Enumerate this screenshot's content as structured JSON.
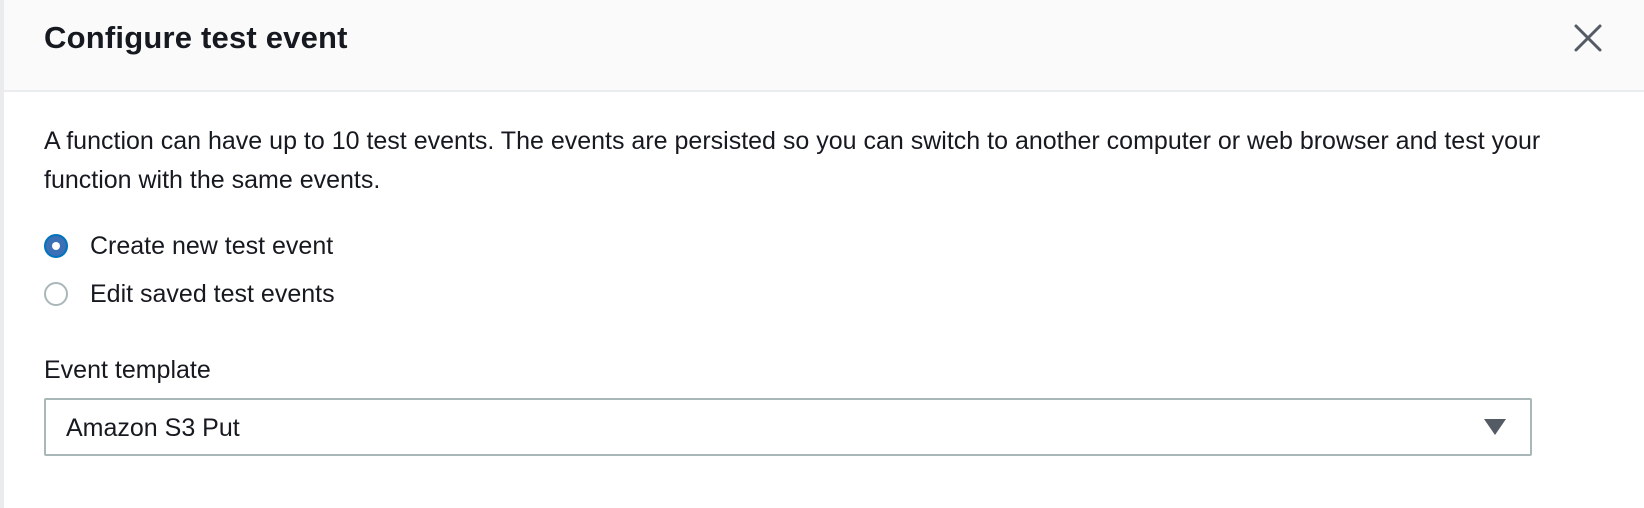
{
  "modal": {
    "title": "Configure test event",
    "description": "A function can have up to 10 test events. The events are persisted so you can switch to another computer or web browser and test your function with the same events."
  },
  "options": [
    {
      "label": "Create new test event",
      "selected": true
    },
    {
      "label": "Edit saved test events",
      "selected": false
    }
  ],
  "event_template": {
    "label": "Event template",
    "value": "Amazon S3 Put"
  },
  "icons": {
    "close": "close-icon",
    "dropdown": "caret-down-icon"
  },
  "colors": {
    "accent": "#3b6fb6",
    "border": "#aab7b8",
    "header_bg": "#fafafa",
    "text": "#16191f"
  }
}
